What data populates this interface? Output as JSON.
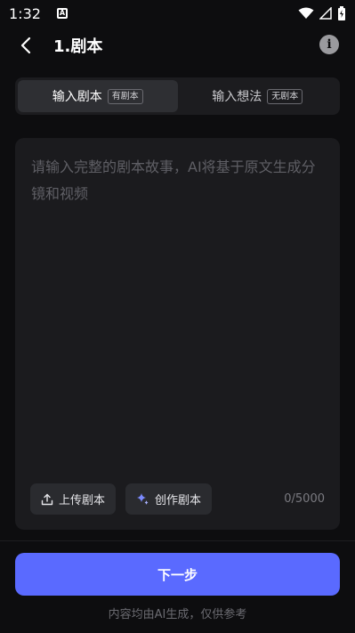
{
  "status_bar": {
    "time": "1:32",
    "notification_icon": "A"
  },
  "header": {
    "title": "1.剧本",
    "back_icon": "chevron-left-icon",
    "info_icon": "info-icon"
  },
  "tabs": [
    {
      "label": "输入剧本",
      "badge": "有剧本",
      "active": true
    },
    {
      "label": "输入想法",
      "badge": "无剧本",
      "active": false
    }
  ],
  "editor": {
    "placeholder": "请输入完整的剧本故事，AI将基于原文生成分镜和视频",
    "value": "",
    "char_count": "0/5000"
  },
  "actions": {
    "upload_label": "上传剧本",
    "create_label": "创作剧本"
  },
  "footer": {
    "next_label": "下一步",
    "disclaimer": "内容均由AI生成，仅供参考"
  },
  "colors": {
    "accent": "#5a6aff",
    "background": "#0d0d0f",
    "card": "#1b1b1e"
  }
}
